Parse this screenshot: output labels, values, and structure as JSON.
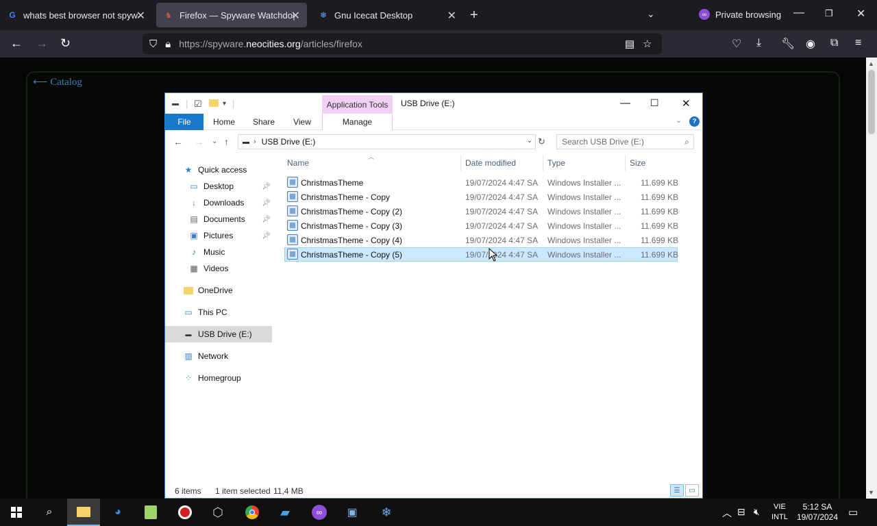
{
  "browser": {
    "tabs": [
      {
        "title": "whats best browser not spyware",
        "favicon": "google-g-icon"
      },
      {
        "title": "Firefox — Spyware Watchdog",
        "favicon": "gnu-icon"
      },
      {
        "title": "Gnu Icecat Desktop",
        "favicon": "icecat-icon"
      }
    ],
    "private_label": "Private browsing",
    "url_prefix": "https://spyware.",
    "url_domain": "neocities.org",
    "url_suffix": "/articles/firefox"
  },
  "page": {
    "back_link": "⟵ Catalog"
  },
  "explorer": {
    "app_tools": "Application Tools",
    "title": "USB Drive (E:)",
    "ribbon": {
      "file": "File",
      "home": "Home",
      "share": "Share",
      "view": "View",
      "manage": "Manage"
    },
    "address_path": "USB Drive (E:)",
    "search_placeholder": "Search USB Drive (E:)",
    "nav": [
      {
        "label": "Quick access",
        "icon": "star-icon"
      },
      {
        "label": "Desktop",
        "icon": "desktop-icon",
        "pinned": true
      },
      {
        "label": "Downloads",
        "icon": "download-icon",
        "pinned": true
      },
      {
        "label": "Documents",
        "icon": "document-icon",
        "pinned": true
      },
      {
        "label": "Pictures",
        "icon": "picture-icon",
        "pinned": true
      },
      {
        "label": "Music",
        "icon": "music-icon"
      },
      {
        "label": "Videos",
        "icon": "video-icon"
      },
      {
        "label": "OneDrive",
        "icon": "folder-icon"
      },
      {
        "label": "This PC",
        "icon": "computer-icon"
      },
      {
        "label": "USB Drive (E:)",
        "icon": "drive-icon",
        "selected": true
      },
      {
        "label": "Network",
        "icon": "network-icon"
      },
      {
        "label": "Homegroup",
        "icon": "homegroup-icon"
      }
    ],
    "columns": {
      "name": "Name",
      "date": "Date modified",
      "type": "Type",
      "size": "Size"
    },
    "files": [
      {
        "name": "ChristmasTheme",
        "date": "19/07/2024 4:47 SA",
        "type": "Windows Installer ...",
        "size": "11.699 KB"
      },
      {
        "name": "ChristmasTheme - Copy",
        "date": "19/07/2024 4:47 SA",
        "type": "Windows Installer ...",
        "size": "11.699 KB"
      },
      {
        "name": "ChristmasTheme - Copy (2)",
        "date": "19/07/2024 4:47 SA",
        "type": "Windows Installer ...",
        "size": "11.699 KB"
      },
      {
        "name": "ChristmasTheme - Copy (3)",
        "date": "19/07/2024 4:47 SA",
        "type": "Windows Installer ...",
        "size": "11.699 KB"
      },
      {
        "name": "ChristmasTheme - Copy (4)",
        "date": "19/07/2024 4:47 SA",
        "type": "Windows Installer ...",
        "size": "11.699 KB"
      },
      {
        "name": "ChristmasTheme - Copy (5)",
        "date": "19/07/2024 4:47 SA",
        "type": "Windows Installer ...",
        "size": "11.699 KB",
        "selected": true
      }
    ],
    "status": {
      "items": "6 items",
      "selected": "1 item selected",
      "size": "11,4 MB"
    }
  },
  "taskbar": {
    "lang_top": "VIE",
    "lang_bottom": "INTL",
    "time": "5:12 SA",
    "date": "19/07/2024"
  },
  "colors": {
    "accent": "#1979ca",
    "selection": "#cce8ff",
    "app_tools": "#f2d0f4"
  }
}
